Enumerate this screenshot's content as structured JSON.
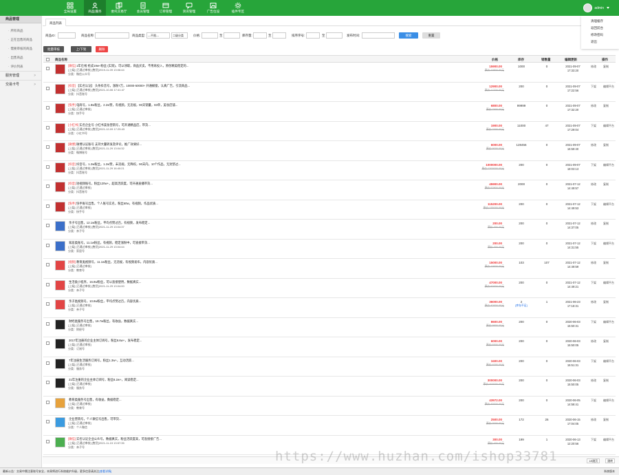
{
  "nav": [
    {
      "label": "全局设置",
      "icon": "grid-icon"
    },
    {
      "label": "商品|服务",
      "icon": "user-icon"
    },
    {
      "label": "委托交易厅",
      "icon": "copy-icon"
    },
    {
      "label": "会员管理",
      "icon": "pages-icon"
    },
    {
      "label": "订单管理",
      "icon": "order-icon"
    },
    {
      "label": "资讯管理",
      "icon": "chat-icon"
    },
    {
      "label": "广告位设",
      "icon": "image-icon"
    },
    {
      "label": "插件专区",
      "icon": "gear-icon"
    }
  ],
  "user": {
    "name": "admin"
  },
  "user_menu": [
    "清理缓存",
    "返回前台",
    "修改密码",
    "退出"
  ],
  "sidebar": {
    "head": "商品管理",
    "items": [
      "所有商品",
      "正在出售的商品",
      "需要审核的商品",
      "出售商品",
      "评价列表"
    ],
    "groups": [
      "服务管理",
      "交易卡号"
    ]
  },
  "tab": "商品列表",
  "filters": {
    "labels": [
      "商品ID:",
      "商品名称:",
      "商品类型:",
      "价格:",
      "至",
      "库存量:",
      "至",
      "排序序号:",
      "至",
      "发布时间:"
    ],
    "type_select": "---不限---",
    "cat_select": "二级分类",
    "search": "搜索",
    "reset": "重置"
  },
  "actions": {
    "batch": "批量审核",
    "toggle": "上/下架",
    "delete": "删除"
  },
  "columns": [
    "商品名称",
    "价格",
    "库存",
    "销售量",
    "编辑更新",
    "操作"
  ],
  "ops": {
    "edit": "修改",
    "copy": "复制",
    "delist": "下架",
    "shelf": "编辑平台"
  },
  "rows": [
    {
      "prefix": "[微信]",
      "title": "1年在线 抢成19w+粉丝 (实际)，可以领取，商品买卖，不用再投入，原创精美稳定的...",
      "line2": "[上架] [已通过审核] [售货]2019-11-09 13:06:44",
      "line3": "分类：微信公众号",
      "price": "15900.00",
      "oprice": "原价:19900.00元",
      "stock": "1000",
      "sales": "0",
      "date": "2021-09-07\n17:33:20",
      "thumb": "#c23030"
    },
    {
      "prefix": "[抖音]",
      "title": "【实名认证】 头条抖音号，涨粉7万，10000-50000+ 开通橱窗，认真广告，引流商品...",
      "line2": "[上架] [已通过审核] [售货]2021-10-06 17:41:47",
      "line3": "分类：抖音账号",
      "price": "12900.00",
      "oprice": "原价:17700.00元",
      "stock": "200",
      "sales": "0",
      "date": "2021-09-07\n17:22:56",
      "thumb": "#c23030"
    },
    {
      "prefix": "[快手]",
      "title": "电商号，1.8w粉丝，2.2w赞，有视频，无违规，90天销量，83单，美妆店铺...",
      "line2": "[上架] [已通过审核]",
      "line3": "分类：快手号",
      "price": "6800.00",
      "oprice": "原价:7900.00元",
      "stock": "99999",
      "sales": "0",
      "date": "2021-09-07\n17:32:20",
      "thumb": "#c23030"
    },
    {
      "prefix": "[小红书]",
      "title": "实名企业号 小红书美妆营销号，可开通精品店，带货...",
      "line2": "[上架] [已通过审核] [售货]2021-12-09 17:25:43",
      "line3": "分类：小红书号",
      "price": "1900.00",
      "oprice": "原价:2300.00元",
      "stock": "11000",
      "sales": "47",
      "date": "2021-09-07\n17:29:04",
      "thumb": "#c23030"
    },
    {
      "prefix": "[微博]",
      "title": "微博认证账号 支持大量转发及评论，推广效果好...",
      "line2": "[上架] [已通过审核] [售货]2021-11-29 13:04:32",
      "line3": "分类：微博账号",
      "price": "6000.00",
      "oprice": "原价:9000.00元",
      "stock": "128456",
      "sales": "0",
      "date": "2021-09-07\n16:59:40",
      "thumb": "#c23030"
    },
    {
      "prefix": "[抖音]",
      "title": "抖音号，1.2w粉丝，1.2w赞，未违规，无降权，90天内，10个作品，无封禁过...",
      "line2": "[上架] [已通过审核] [售货]2021-11-29 16:40:21",
      "line3": "分类：抖音账号",
      "price": "1000000.00",
      "oprice": "原价:1200000.00元",
      "stock": "200",
      "sales": "0",
      "date": "2021-09-07\n18:03:13",
      "thumb": "#c23030"
    },
    {
      "prefix": "[抖音]",
      "title": "短视频账号，粉丝120w+，超高活跃度，可开通直播带货...",
      "line2": "[上架] [已通过审核]",
      "line3": "分类：抖音账号",
      "price": "45900.00",
      "oprice": "原价:52900.00元",
      "stock": "2000",
      "sales": "0",
      "date": "2021-07-12\n14:49:57",
      "thumb": "#c23030"
    },
    {
      "prefix": "[快手]",
      "title": "快手账号出售，个人账号实名，粉丝60w，有视频，作品优质...",
      "line2": "[上架] [已通过审核]",
      "line3": "分类：快手号",
      "price": "115200.00",
      "oprice": "原价:135000.00元",
      "stock": "200",
      "sales": "0",
      "date": "2021-07-12\n14:49:53",
      "thumb": "#c23030"
    },
    {
      "prefix": "",
      "title": "亲子号出售，12.1w粉丝，平均点赞过百，有视频，发布稳定...",
      "line2": "[上架] [已通过审核] [售货]2021-11-29 13:04:37",
      "line3": "分类：亲子号",
      "price": "200.00",
      "oprice": "原价:300.00元",
      "stock": "200",
      "sales": "0",
      "date": "2021-07-12\n14:37:05",
      "thumb": "#3b6fc9"
    },
    {
      "prefix": "",
      "title": "家居类账号，11.1w粉丝，有视频，稳定涨粉中，可直接带货...",
      "line2": "[上架] [已通过审核] [售货]2021-11-29 13:04:44",
      "line3": "分类：家居号",
      "price": "200.00",
      "oprice": "原价:300.00元",
      "stock": "200",
      "sales": "0",
      "date": "2021-07-12\n14:31:55",
      "thumb": "#3b6fc9"
    },
    {
      "prefix": "[视频]",
      "title": "教育类视频号，11.1w粉丝，无违规，有视频发布，内容优质...",
      "line2": "[上架] [已通过审核]",
      "line3": "分类：教育号",
      "price": "15000.00",
      "oprice": "原价:19000.00元",
      "stock": "103",
      "sales": "107",
      "date": "2021-07-12\n14:49:59",
      "thumb": "#e24545"
    },
    {
      "prefix": "",
      "title": "生活类小程序，16.8w粉丝，可以直接使用，数据真实...",
      "line2": "[上架] [已通过审核] [售货]2021-11-29 13:04:00",
      "line3": "分类：亲子号",
      "price": "47000.00",
      "oprice": "原价:50000.00元",
      "stock": "200",
      "sales": "0",
      "date": "2021-07-12\n14:49:21",
      "thumb": "#e24545"
    },
    {
      "prefix": "",
      "title": "亲子类视频号，10.8w粉丝，平均点赞过百，内容优质...",
      "line2": "[上架] [已通过审核]",
      "line3": "分类：亲子号",
      "price": "36000.00",
      "oprice": "原价:40000.00元",
      "stock": "2",
      "sales": "1",
      "date": "2021-06-23\n17:18:31",
      "thumb": "#e24545",
      "stockNote": "[库存不足]"
    },
    {
      "prefix": "",
      "title": "财经类服务号出售，19.7w粉丝，有收益，数据真实...",
      "line2": "[上架] [已通过审核]",
      "line3": "分类：财经号",
      "price": "8600.00",
      "oprice": "原价:9900.00元",
      "stock": "200",
      "sales": "0",
      "date": "2020-06-03\n15:50:31",
      "thumb": "#222222"
    },
    {
      "prefix": "",
      "title": "2017年注册的企业主体订阅号，粉丝8.6w+，发布稳定...",
      "line2": "[上架] [已通过审核]",
      "line3": "分类：订阅号",
      "price": "6000.00",
      "oprice": "原价:6500.00元",
      "stock": "200",
      "sales": "0",
      "date": "2020-06-03\n15:50:05",
      "thumb": "#222222"
    },
    {
      "prefix": "",
      "title": "7年注册生活服务订阅号，粉丝1.3w+，互动活跃...",
      "line2": "[上架] [已通过审核]",
      "line3": "分类：服务号",
      "price": "3400.00",
      "oprice": "原价:4000.00元",
      "stock": "200",
      "sales": "0",
      "date": "2020-06-03\n15:51:31",
      "thumb": "#222222"
    },
    {
      "prefix": "",
      "title": "21年注册的企业主体订阅号，粉丝8.2w+，阅读稳定...",
      "line2": "[上架] [已通过审核]",
      "line3": "分类：服务号",
      "price": "300000.00",
      "oprice": "原价:400000.00元",
      "stock": "200",
      "sales": "0",
      "date": "2020-06-03\n15:50:05",
      "thumb": "#222222"
    },
    {
      "prefix": "",
      "title": "教育类服务号出售，有收益，数据稳定...",
      "line2": "[上架] [已通过审核]",
      "line3": "分类：教育号",
      "price": "43972.00",
      "oprice": "原价:45000.00元",
      "stock": "200",
      "sales": "0",
      "date": "2020-06-05\n14:58:41",
      "thumb": "#e7a23c"
    },
    {
      "prefix": "",
      "title": "企业营销号，个人微信号出售，可带货...",
      "line2": "[上架] [已通过审核]",
      "line3": "分类：个人微信",
      "price": "2500.00",
      "oprice": "原价:3000.00元",
      "stock": "172",
      "sales": "26",
      "date": "2020-06-15\n17:04:05",
      "thumb": "#3b9be0"
    },
    {
      "prefix": "[微信]",
      "title": "实名认证企业公众号，数据真实，粉丝活跃度高，可直接接广告...",
      "line2": "[上架] [已通过审核] [售货]2021-11-15 13:57:35",
      "line3": "分类：亲子号",
      "price": "300.00",
      "oprice": "原价:400.00元",
      "stock": "199",
      "sales": "1",
      "date": "2020-06-13\n12:20:56",
      "thumb": "#4caf50"
    }
  ],
  "pager": {
    "btn1": "1/8跳页",
    "btn2": "跳转"
  },
  "status": {
    "left": "最新公告：交易中需注意账号安全，本周将进行系统维护升级，更多信息请关注",
    "link": "[查看详情]",
    "right": "系统版本"
  },
  "watermark": "https://www.huzhan.com/ishop33781"
}
